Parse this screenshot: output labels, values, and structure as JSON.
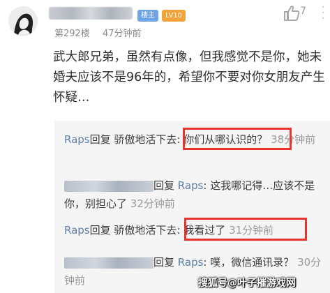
{
  "comment": {
    "avatar_icon": "user-avatar-icon",
    "badges": {
      "owner": "楼主",
      "level": "LV10"
    },
    "floor": "第292楼",
    "time": "47分钟前",
    "like_count": "7",
    "text": "武大郎兄弟，虽然有点像，但我感觉不是你，她未婚夫应该不是96年的，希望你不要对你女朋友产生怀疑…"
  },
  "replies": [
    {
      "author": "Raps",
      "verb": "回复",
      "target": "骄傲地活下去",
      "sep": ":",
      "text": "你们从哪认识的？",
      "time": "38分钟前",
      "highlight": true
    },
    {
      "author": "",
      "verb": "回复",
      "target": "Raps",
      "sep": ":",
      "text": "这我哪记得…应该不是你，别担心了",
      "time": "32分钟前",
      "highlight": false
    },
    {
      "author": "Raps",
      "verb": "回复",
      "target": "骄傲地活下去",
      "sep": ":",
      "text": "我看过了",
      "time": "31分钟前",
      "highlight": true
    },
    {
      "author": "",
      "verb": "回复",
      "target": "Raps",
      "sep": ":",
      "text": "噗，微信通讯录？",
      "time": "30分钟前",
      "highlight": false
    }
  ],
  "colors": {
    "username_blue": "#5e7ea8",
    "highlight_red": "#e8342a",
    "level_badge": "#f2a33a",
    "owner_badge": "#6fa3e8"
  },
  "watermark": "搜狐号@叶子摧游戏网"
}
